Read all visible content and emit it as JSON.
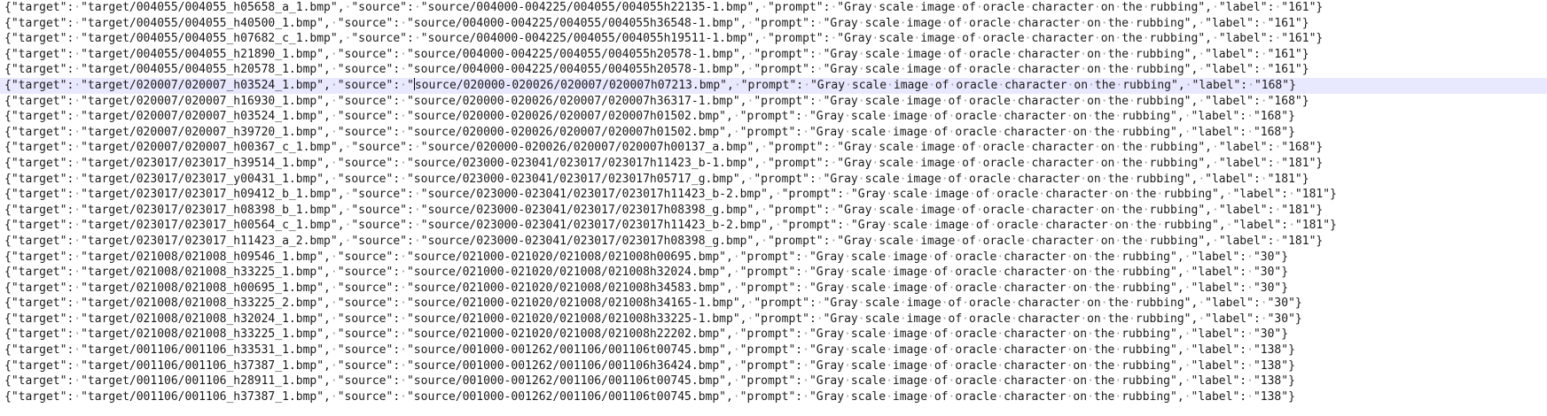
{
  "editor": {
    "current_line_index": 5,
    "caret_after_text": "{\"target\": \"target/020007/020007_h03524_1.bmp\", \"source\": \"",
    "lines": [
      "{\"target\": \"target/004055/004055_h05658_a_1.bmp\", \"source\": \"source/004000-004225/004055/004055h22135-1.bmp\", \"prompt\": \"Gray scale image of oracle character on the rubbing\", \"label\": \"161\"}",
      "{\"target\": \"target/004055/004055_h40500_1.bmp\", \"source\": \"source/004000-004225/004055/004055h36548-1.bmp\", \"prompt\": \"Gray scale image of oracle character on the rubbing\", \"label\": \"161\"}",
      "{\"target\": \"target/004055/004055_h07682_c_1.bmp\", \"source\": \"source/004000-004225/004055/004055h19511-1.bmp\", \"prompt\": \"Gray scale image of oracle character on the rubbing\", \"label\": \"161\"}",
      "{\"target\": \"target/004055/004055_h21890_1.bmp\", \"source\": \"source/004000-004225/004055/004055h20578-1.bmp\", \"prompt\": \"Gray scale image of oracle character on the rubbing\", \"label\": \"161\"}",
      "{\"target\": \"target/004055/004055_h20578_1.bmp\", \"source\": \"source/004000-004225/004055/004055h20578-1.bmp\", \"prompt\": \"Gray scale image of oracle character on the rubbing\", \"label\": \"161\"}",
      "{\"target\": \"target/020007/020007_h03524_1.bmp\", \"source\": \"source/020000-020026/020007/020007h07213.bmp\", \"prompt\": \"Gray scale image of oracle character on the rubbing\", \"label\": \"168\"}",
      "{\"target\": \"target/020007/020007_h16930_1.bmp\", \"source\": \"source/020000-020026/020007/020007h36317-1.bmp\", \"prompt\": \"Gray scale image of oracle character on the rubbing\", \"label\": \"168\"}",
      "{\"target\": \"target/020007/020007_h03524_1.bmp\", \"source\": \"source/020000-020026/020007/020007h01502.bmp\", \"prompt\": \"Gray scale image of oracle character on the rubbing\", \"label\": \"168\"}",
      "{\"target\": \"target/020007/020007_h39720_1.bmp\", \"source\": \"source/020000-020026/020007/020007h01502.bmp\", \"prompt\": \"Gray scale image of oracle character on the rubbing\", \"label\": \"168\"}",
      "{\"target\": \"target/020007/020007_h00367_c_1.bmp\", \"source\": \"source/020000-020026/020007/020007h00137_a.bmp\", \"prompt\": \"Gray scale image of oracle character on the rubbing\", \"label\": \"168\"}",
      "{\"target\": \"target/023017/023017_h39514_1.bmp\", \"source\": \"source/023000-023041/023017/023017h11423_b-1.bmp\", \"prompt\": \"Gray scale image of oracle character on the rubbing\", \"label\": \"181\"}",
      "{\"target\": \"target/023017/023017_y00431_1.bmp\", \"source\": \"source/023000-023041/023017/023017h05717_g.bmp\", \"prompt\": \"Gray scale image of oracle character on the rubbing\", \"label\": \"181\"}",
      "{\"target\": \"target/023017/023017_h09412_b_1.bmp\", \"source\": \"source/023000-023041/023017/023017h11423_b-2.bmp\", \"prompt\": \"Gray scale image of oracle character on the rubbing\", \"label\": \"181\"}",
      "{\"target\": \"target/023017/023017_h08398_b_1.bmp\", \"source\": \"source/023000-023041/023017/023017h08398_g.bmp\", \"prompt\": \"Gray scale image of oracle character on the rubbing\", \"label\": \"181\"}",
      "{\"target\": \"target/023017/023017_h00564_c_1.bmp\", \"source\": \"source/023000-023041/023017/023017h11423_b-2.bmp\", \"prompt\": \"Gray scale image of oracle character on the rubbing\", \"label\": \"181\"}",
      "{\"target\": \"target/023017/023017_h11423_a_2.bmp\", \"source\": \"source/023000-023041/023017/023017h08398_g.bmp\", \"prompt\": \"Gray scale image of oracle character on the rubbing\", \"label\": \"181\"}",
      "{\"target\": \"target/021008/021008_h09546_1.bmp\", \"source\": \"source/021000-021020/021008/021008h00695.bmp\", \"prompt\": \"Gray scale image of oracle character on the rubbing\", \"label\": \"30\"}",
      "{\"target\": \"target/021008/021008_h33225_1.bmp\", \"source\": \"source/021000-021020/021008/021008h32024.bmp\", \"prompt\": \"Gray scale image of oracle character on the rubbing\", \"label\": \"30\"}",
      "{\"target\": \"target/021008/021008_h00695_1.bmp\", \"source\": \"source/021000-021020/021008/021008h34583.bmp\", \"prompt\": \"Gray scale image of oracle character on the rubbing\", \"label\": \"30\"}",
      "{\"target\": \"target/021008/021008_h33225_2.bmp\", \"source\": \"source/021000-021020/021008/021008h34165-1.bmp\", \"prompt\": \"Gray scale image of oracle character on the rubbing\", \"label\": \"30\"}",
      "{\"target\": \"target/021008/021008_h32024_1.bmp\", \"source\": \"source/021000-021020/021008/021008h33225-1.bmp\", \"prompt\": \"Gray scale image of oracle character on the rubbing\", \"label\": \"30\"}",
      "{\"target\": \"target/021008/021008_h33225_1.bmp\", \"source\": \"source/021000-021020/021008/021008h22202.bmp\", \"prompt\": \"Gray scale image of oracle character on the rubbing\", \"label\": \"30\"}",
      "{\"target\": \"target/001106/001106_h33531_1.bmp\", \"source\": \"source/001000-001262/001106/001106t00745.bmp\", \"prompt\": \"Gray scale image of oracle character on the rubbing\", \"label\": \"138\"}",
      "{\"target\": \"target/001106/001106_h37387_1.bmp\", \"source\": \"source/001000-001262/001106/001106h36424.bmp\", \"prompt\": \"Gray scale image of oracle character on the rubbing\", \"label\": \"138\"}",
      "{\"target\": \"target/001106/001106_h28911_1.bmp\", \"source\": \"source/001000-001262/001106/001106t00745.bmp\", \"prompt\": \"Gray scale image of oracle character on the rubbing\", \"label\": \"138\"}",
      "{\"target\": \"target/001106/001106_h37387_1.bmp\", \"source\": \"source/001000-001262/001106/001106t00745.bmp\", \"prompt\": \"Gray scale image of oracle character on the rubbing\", \"label\": \"138\"}"
    ]
  }
}
